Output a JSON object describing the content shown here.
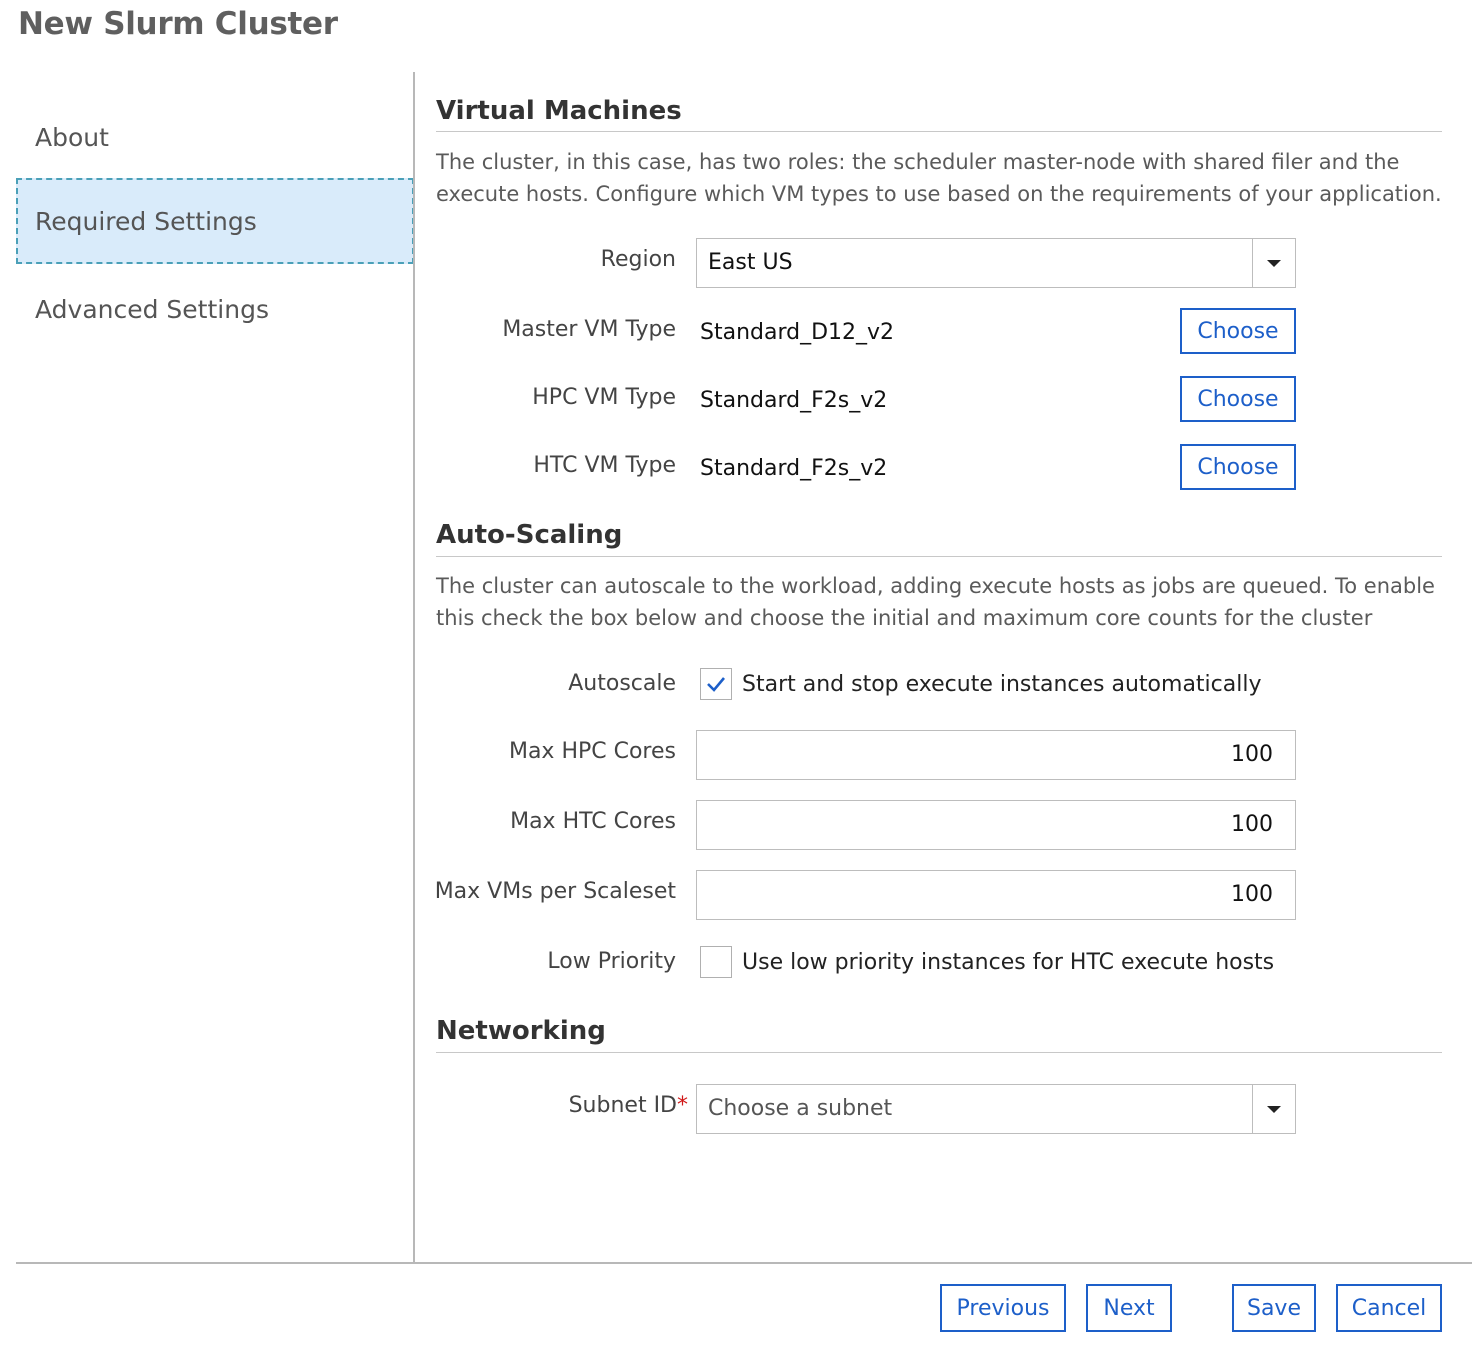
{
  "page_title": "New Slurm Cluster",
  "sidebar": {
    "items": [
      {
        "label": "About"
      },
      {
        "label": "Required Settings"
      },
      {
        "label": "Advanced Settings"
      }
    ]
  },
  "virtual_machines": {
    "title": "Virtual Machines",
    "description": "The cluster, in this case, has two roles: the scheduler master-node with shared filer and the execute hosts. Configure which VM types to use based on the requirements of your application.",
    "region": {
      "label": "Region",
      "value": "East US"
    },
    "master": {
      "label": "Master VM Type",
      "value": "Standard_D12_v2",
      "button": "Choose"
    },
    "hpc": {
      "label": "HPC VM Type",
      "value": "Standard_F2s_v2",
      "button": "Choose"
    },
    "htc": {
      "label": "HTC VM Type",
      "value": "Standard_F2s_v2",
      "button": "Choose"
    }
  },
  "auto_scaling": {
    "title": "Auto-Scaling",
    "description": "The cluster can autoscale to the workload, adding execute hosts as jobs are queued. To enable this check the box below and choose the initial and maximum core counts for the cluster",
    "autoscale": {
      "label": "Autoscale",
      "checkbox_label": "Start and stop execute instances automatically",
      "checked": true
    },
    "max_hpc": {
      "label": "Max HPC Cores",
      "value": "100"
    },
    "max_htc": {
      "label": "Max HTC Cores",
      "value": "100"
    },
    "max_vms": {
      "label": "Max VMs per Scaleset",
      "value": "100"
    },
    "low_priority": {
      "label": "Low Priority",
      "checkbox_label": "Use low priority instances for HTC execute hosts",
      "checked": false
    }
  },
  "networking": {
    "title": "Networking",
    "subnet": {
      "label": "Subnet ID",
      "required_mark": "*",
      "placeholder": "Choose a subnet"
    }
  },
  "footer": {
    "previous": "Previous",
    "next": "Next",
    "save": "Save",
    "cancel": "Cancel"
  },
  "colors": {
    "accent": "#1d5fc9",
    "active_nav_bg": "#d9ebfa",
    "active_nav_border": "#4ba0b8",
    "required": "#d01818"
  }
}
